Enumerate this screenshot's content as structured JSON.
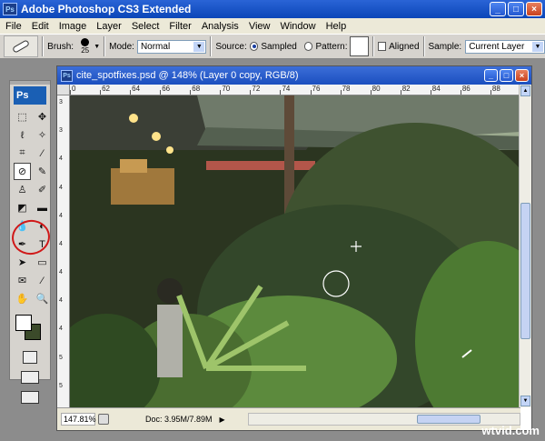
{
  "app": {
    "title": "Adobe Photoshop CS3 Extended",
    "ps_label": "Ps"
  },
  "window_buttons": {
    "minimize": "_",
    "maximize": "□",
    "close": "×"
  },
  "menu": [
    "File",
    "Edit",
    "Image",
    "Layer",
    "Select",
    "Filter",
    "Analysis",
    "View",
    "Window",
    "Help"
  ],
  "options": {
    "brush_label": "Brush:",
    "brush_size": "25",
    "mode_label": "Mode:",
    "mode_value": "Normal",
    "source_label": "Source:",
    "sampled_label": "Sampled",
    "pattern_label": "Pattern:",
    "aligned_label": "Aligned",
    "sample_label": "Sample:",
    "sample_value": "Current Layer"
  },
  "toolbox": {
    "tools": [
      {
        "name": "marquee-tool-icon",
        "glyph": "⬚",
        "active": false
      },
      {
        "name": "move-tool-icon",
        "glyph": "✥",
        "active": false
      },
      {
        "name": "lasso-tool-icon",
        "glyph": "ℓ",
        "active": false
      },
      {
        "name": "magic-wand-tool-icon",
        "glyph": "✧",
        "active": false
      },
      {
        "name": "crop-tool-icon",
        "glyph": "⌗",
        "active": false
      },
      {
        "name": "eyedropper-tool-icon",
        "glyph": "⁄",
        "active": false
      },
      {
        "name": "spot-healing-brush-tool-icon",
        "glyph": "⊘",
        "active": true
      },
      {
        "name": "brush-tool-icon",
        "glyph": "✎",
        "active": false
      },
      {
        "name": "clone-stamp-tool-icon",
        "glyph": "♙",
        "active": false
      },
      {
        "name": "history-brush-tool-icon",
        "glyph": "✐",
        "active": false
      },
      {
        "name": "eraser-tool-icon",
        "glyph": "◩",
        "active": false
      },
      {
        "name": "gradient-tool-icon",
        "glyph": "▬",
        "active": false
      },
      {
        "name": "blur-tool-icon",
        "glyph": "💧",
        "active": false
      },
      {
        "name": "dodge-tool-icon",
        "glyph": "◐",
        "active": false
      },
      {
        "name": "pen-tool-icon",
        "glyph": "✒",
        "active": false
      },
      {
        "name": "type-tool-icon",
        "glyph": "T",
        "active": false
      },
      {
        "name": "path-selection-tool-icon",
        "glyph": "➤",
        "active": false
      },
      {
        "name": "shape-tool-icon",
        "glyph": "▭",
        "active": false
      },
      {
        "name": "notes-tool-icon",
        "glyph": "✉",
        "active": false
      },
      {
        "name": "eyedropper-sample-tool-icon",
        "glyph": "⁄",
        "active": false
      },
      {
        "name": "hand-tool-icon",
        "glyph": "✋",
        "active": false
      },
      {
        "name": "zoom-tool-icon",
        "glyph": "🔍",
        "active": false
      }
    ],
    "foreground_color": "#ffffff",
    "background_color": "#3b4a2a"
  },
  "document": {
    "title": "cite_spotfixes.psd @ 148% (Layer 0 copy, RGB/8)",
    "ruler_h": [
      "0",
      "62",
      "64",
      "66",
      "68",
      "70",
      "72",
      "74",
      "76",
      "78",
      "80",
      "82",
      "84",
      "86",
      "88"
    ],
    "ruler_v": [
      "3",
      "3",
      "4",
      "4",
      "4",
      "4",
      "4",
      "4",
      "4",
      "5",
      "5"
    ],
    "zoom": "147.81%",
    "doc_info": "Doc: 3.95M/7.89M"
  },
  "watermark": "wtvid.com",
  "colors": {
    "accent": "#0b46b8",
    "highlight_circle": "#d01818"
  }
}
